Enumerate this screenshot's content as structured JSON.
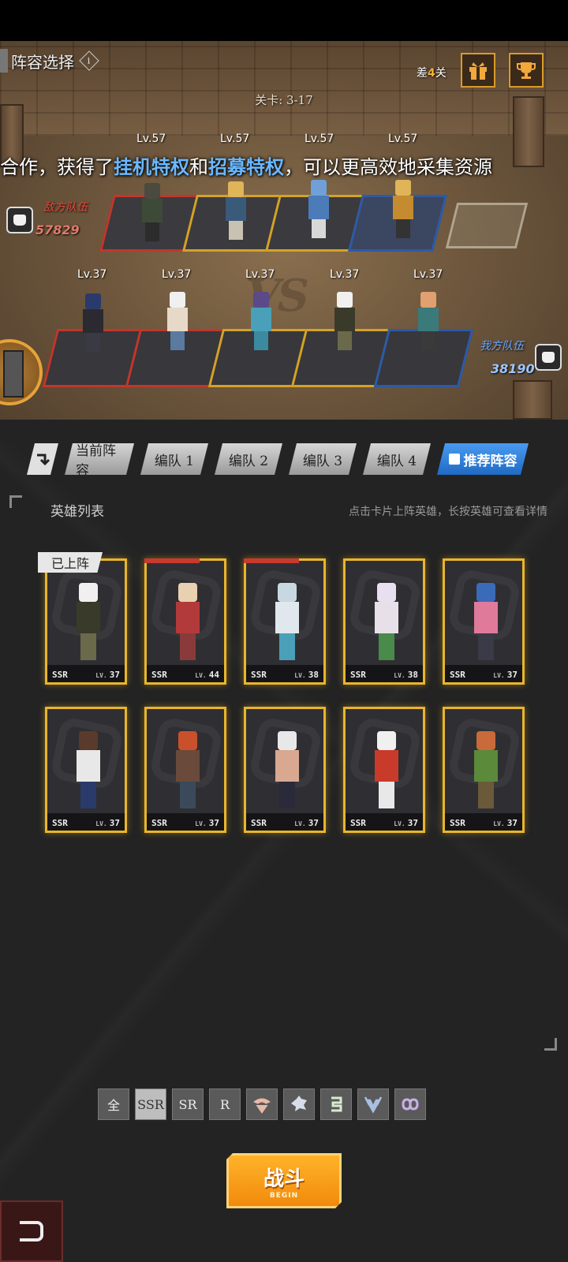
{
  "header": {
    "title": "阵容选择",
    "info_icon": "i",
    "stage": "关卡: 3-17",
    "chest_prefix": "差",
    "chest_count": "4",
    "chest_suffix": "关"
  },
  "marquee": {
    "text_1": "合作，获得了",
    "hl_1": "挂机特权",
    "text_2": "和",
    "hl_2": "招募特权",
    "text_3": "，可以更高效地采集资源"
  },
  "enemy": {
    "label": "敌方队伍",
    "power": "57829",
    "levels": [
      "Lv.57",
      "Lv.57",
      "Lv.57",
      "Lv.57"
    ]
  },
  "ally": {
    "label": "我方队伍",
    "power": "38190",
    "levels": [
      "Lv.37",
      "Lv.37",
      "Lv.37",
      "Lv.37",
      "Lv.37"
    ]
  },
  "tabs": [
    {
      "label": "当前阵容"
    },
    {
      "label": "编队 1"
    },
    {
      "label": "编队 2"
    },
    {
      "label": "编队 3"
    },
    {
      "label": "编队 4"
    },
    {
      "label": "推荐阵容"
    }
  ],
  "hero_list": {
    "title": "英雄列表",
    "hint": "点击卡片上阵英雄，长按英雄可查看详情",
    "deployed_tag": "已上阵",
    "level_prefix": "LV.",
    "cards": [
      {
        "rarity": "SSR",
        "level": "37"
      },
      {
        "rarity": "SSR",
        "level": "44"
      },
      {
        "rarity": "SSR",
        "level": "38"
      },
      {
        "rarity": "SSR",
        "level": "38"
      },
      {
        "rarity": "SSR",
        "level": "37"
      },
      {
        "rarity": "SSR",
        "level": "37"
      },
      {
        "rarity": "SSR",
        "level": "37"
      },
      {
        "rarity": "SSR",
        "level": "37"
      },
      {
        "rarity": "SSR",
        "level": "37"
      },
      {
        "rarity": "SSR",
        "level": "37"
      }
    ]
  },
  "filters": [
    {
      "label": "全"
    },
    {
      "label": "SSR"
    },
    {
      "label": "SR"
    },
    {
      "label": "R"
    }
  ],
  "battle": {
    "label": "战斗",
    "sub": "BEGIN"
  },
  "colors": {
    "gold": "#e9b52b",
    "red": "#c93a2c",
    "blue": "#2d5aa8",
    "accent_blue": "#6ab8ff",
    "orange": "#f28a0c"
  }
}
